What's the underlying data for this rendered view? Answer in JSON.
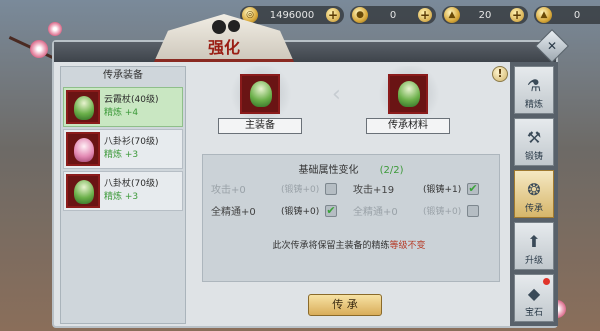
{
  "title": "强化",
  "currency": [
    {
      "name": "coin-icon",
      "value": "1496000"
    },
    {
      "name": "ingot-icon",
      "value": "0"
    },
    {
      "name": "gold-ingot-icon",
      "value": "20"
    },
    {
      "name": "silver-ingot-icon",
      "value": "0"
    }
  ],
  "left": {
    "header": "传承装备",
    "items": [
      {
        "name": "云霞杖(40级)",
        "refine": "精炼 +4",
        "selected": true
      },
      {
        "name": "八卦衫(70级)",
        "refine": "精炼 +3",
        "selected": false
      },
      {
        "name": "八卦杖(70级)",
        "refine": "精炼 +3",
        "selected": false
      }
    ]
  },
  "slots": {
    "main_label": "主装备",
    "material_label": "传承材料"
  },
  "attributes": {
    "title": "基础属性变化",
    "count": "(2/2)",
    "rows": [
      {
        "label": "攻击+0",
        "tag": "(锻铸+0)",
        "checked": false
      },
      {
        "label": "攻击+19",
        "tag": "(锻铸+1)",
        "checked": true
      },
      {
        "label": "全精通+0",
        "tag": "(锻铸+0)",
        "checked": true
      },
      {
        "label": "全精通+0",
        "tag": "(锻铸+0)",
        "checked": false
      }
    ]
  },
  "note": {
    "prefix": "此次传承将保留主装备的精练",
    "warn": "等级不变"
  },
  "button_label": "传 承",
  "tabs": [
    {
      "label": "精炼",
      "active": false
    },
    {
      "label": "锻铸",
      "active": false
    },
    {
      "label": "传承",
      "active": true
    },
    {
      "label": "升级",
      "active": false
    },
    {
      "label": "宝石",
      "active": false
    }
  ],
  "colors": {
    "title_red": "#9a1e14",
    "refine_green": "#3d9a3a",
    "warn_red": "#b53a26"
  }
}
